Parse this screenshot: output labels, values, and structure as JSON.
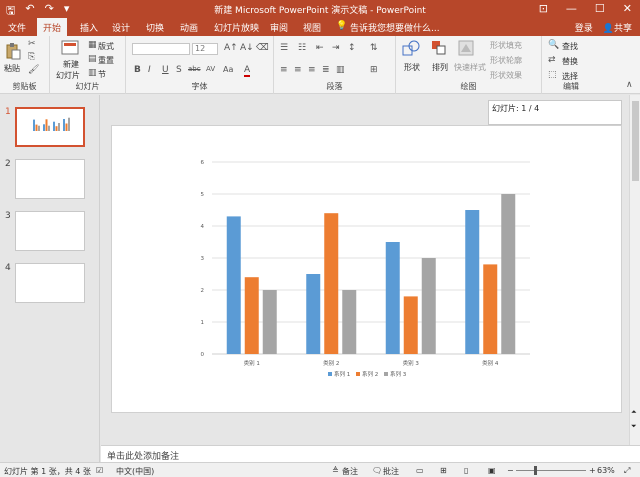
{
  "window": {
    "title": "新建 Microsoft PowerPoint 演示文稿 - PowerPoint",
    "qat": {
      "save": "🖫",
      "undo": "↶",
      "redo": "↷",
      "customize": "▾"
    },
    "controls": {
      "ribbon_opts": "⊡",
      "minimize": "—",
      "maximize": "☐",
      "close": "✕"
    }
  },
  "tabs": {
    "file": "文件",
    "home": "开始",
    "insert": "插入",
    "design": "设计",
    "transitions": "切换",
    "animations": "动画",
    "slideshow": "幻灯片放映",
    "review": "审阅",
    "view": "视图",
    "tellme": "告诉我您想要做什么...",
    "signin": "登录",
    "share": "共享"
  },
  "ribbon": {
    "clipboard": {
      "label": "剪贴板",
      "paste": "粘贴"
    },
    "slides": {
      "label": "幻灯片",
      "new_slide_line1": "新建",
      "new_slide_line2": "幻灯片",
      "layout": "版式",
      "reset": "重置",
      "section": "节"
    },
    "font": {
      "label": "字体",
      "font_name": "",
      "font_size": "12",
      "bold": "B",
      "italic": "I",
      "underline": "U",
      "shadow": "S",
      "strike": "abc",
      "spacing": "AV",
      "case": "Aa",
      "color": "A"
    },
    "paragraph": {
      "label": "段落"
    },
    "drawing": {
      "label": "绘图",
      "shapes": "形状",
      "arrange": "排列",
      "quick_styles": "快速样式",
      "fill": "形状填充",
      "outline": "形状轮廓",
      "effects": "形状效果"
    },
    "editing": {
      "label": "编辑",
      "find": "查找",
      "replace": "替换",
      "select": "选择"
    }
  },
  "thumbnails": [
    "1",
    "2",
    "3",
    "4"
  ],
  "slide_counter": "幻灯片: 1 / 4",
  "notes_placeholder": "单击此处添加备注",
  "status": {
    "slide_info": "幻灯片 第 1 张，共 4 张",
    "language": "中文(中国)",
    "notes": "备注",
    "comments": "批注",
    "zoom": "63%",
    "zoom_minus": "−",
    "zoom_plus": "+",
    "zoom_level": 0.63
  },
  "colors": {
    "accent": "#b7472a",
    "series1": "#5b9bd5",
    "series2": "#ed7d31",
    "series3": "#a5a5a5"
  },
  "chart_data": {
    "type": "bar",
    "categories": [
      "类别 1",
      "类别 2",
      "类别 3",
      "类别 4"
    ],
    "series": [
      {
        "name": "系列 1",
        "values": [
          4.3,
          2.5,
          3.5,
          4.5
        ]
      },
      {
        "name": "系列 2",
        "values": [
          2.4,
          4.4,
          1.8,
          2.8
        ]
      },
      {
        "name": "系列 3",
        "values": [
          2,
          2,
          3,
          5
        ]
      }
    ],
    "yticks": [
      "0",
      "1",
      "2",
      "3",
      "4",
      "5",
      "6"
    ],
    "ylim": [
      0,
      6
    ],
    "grid": true,
    "legend": "bottom"
  }
}
